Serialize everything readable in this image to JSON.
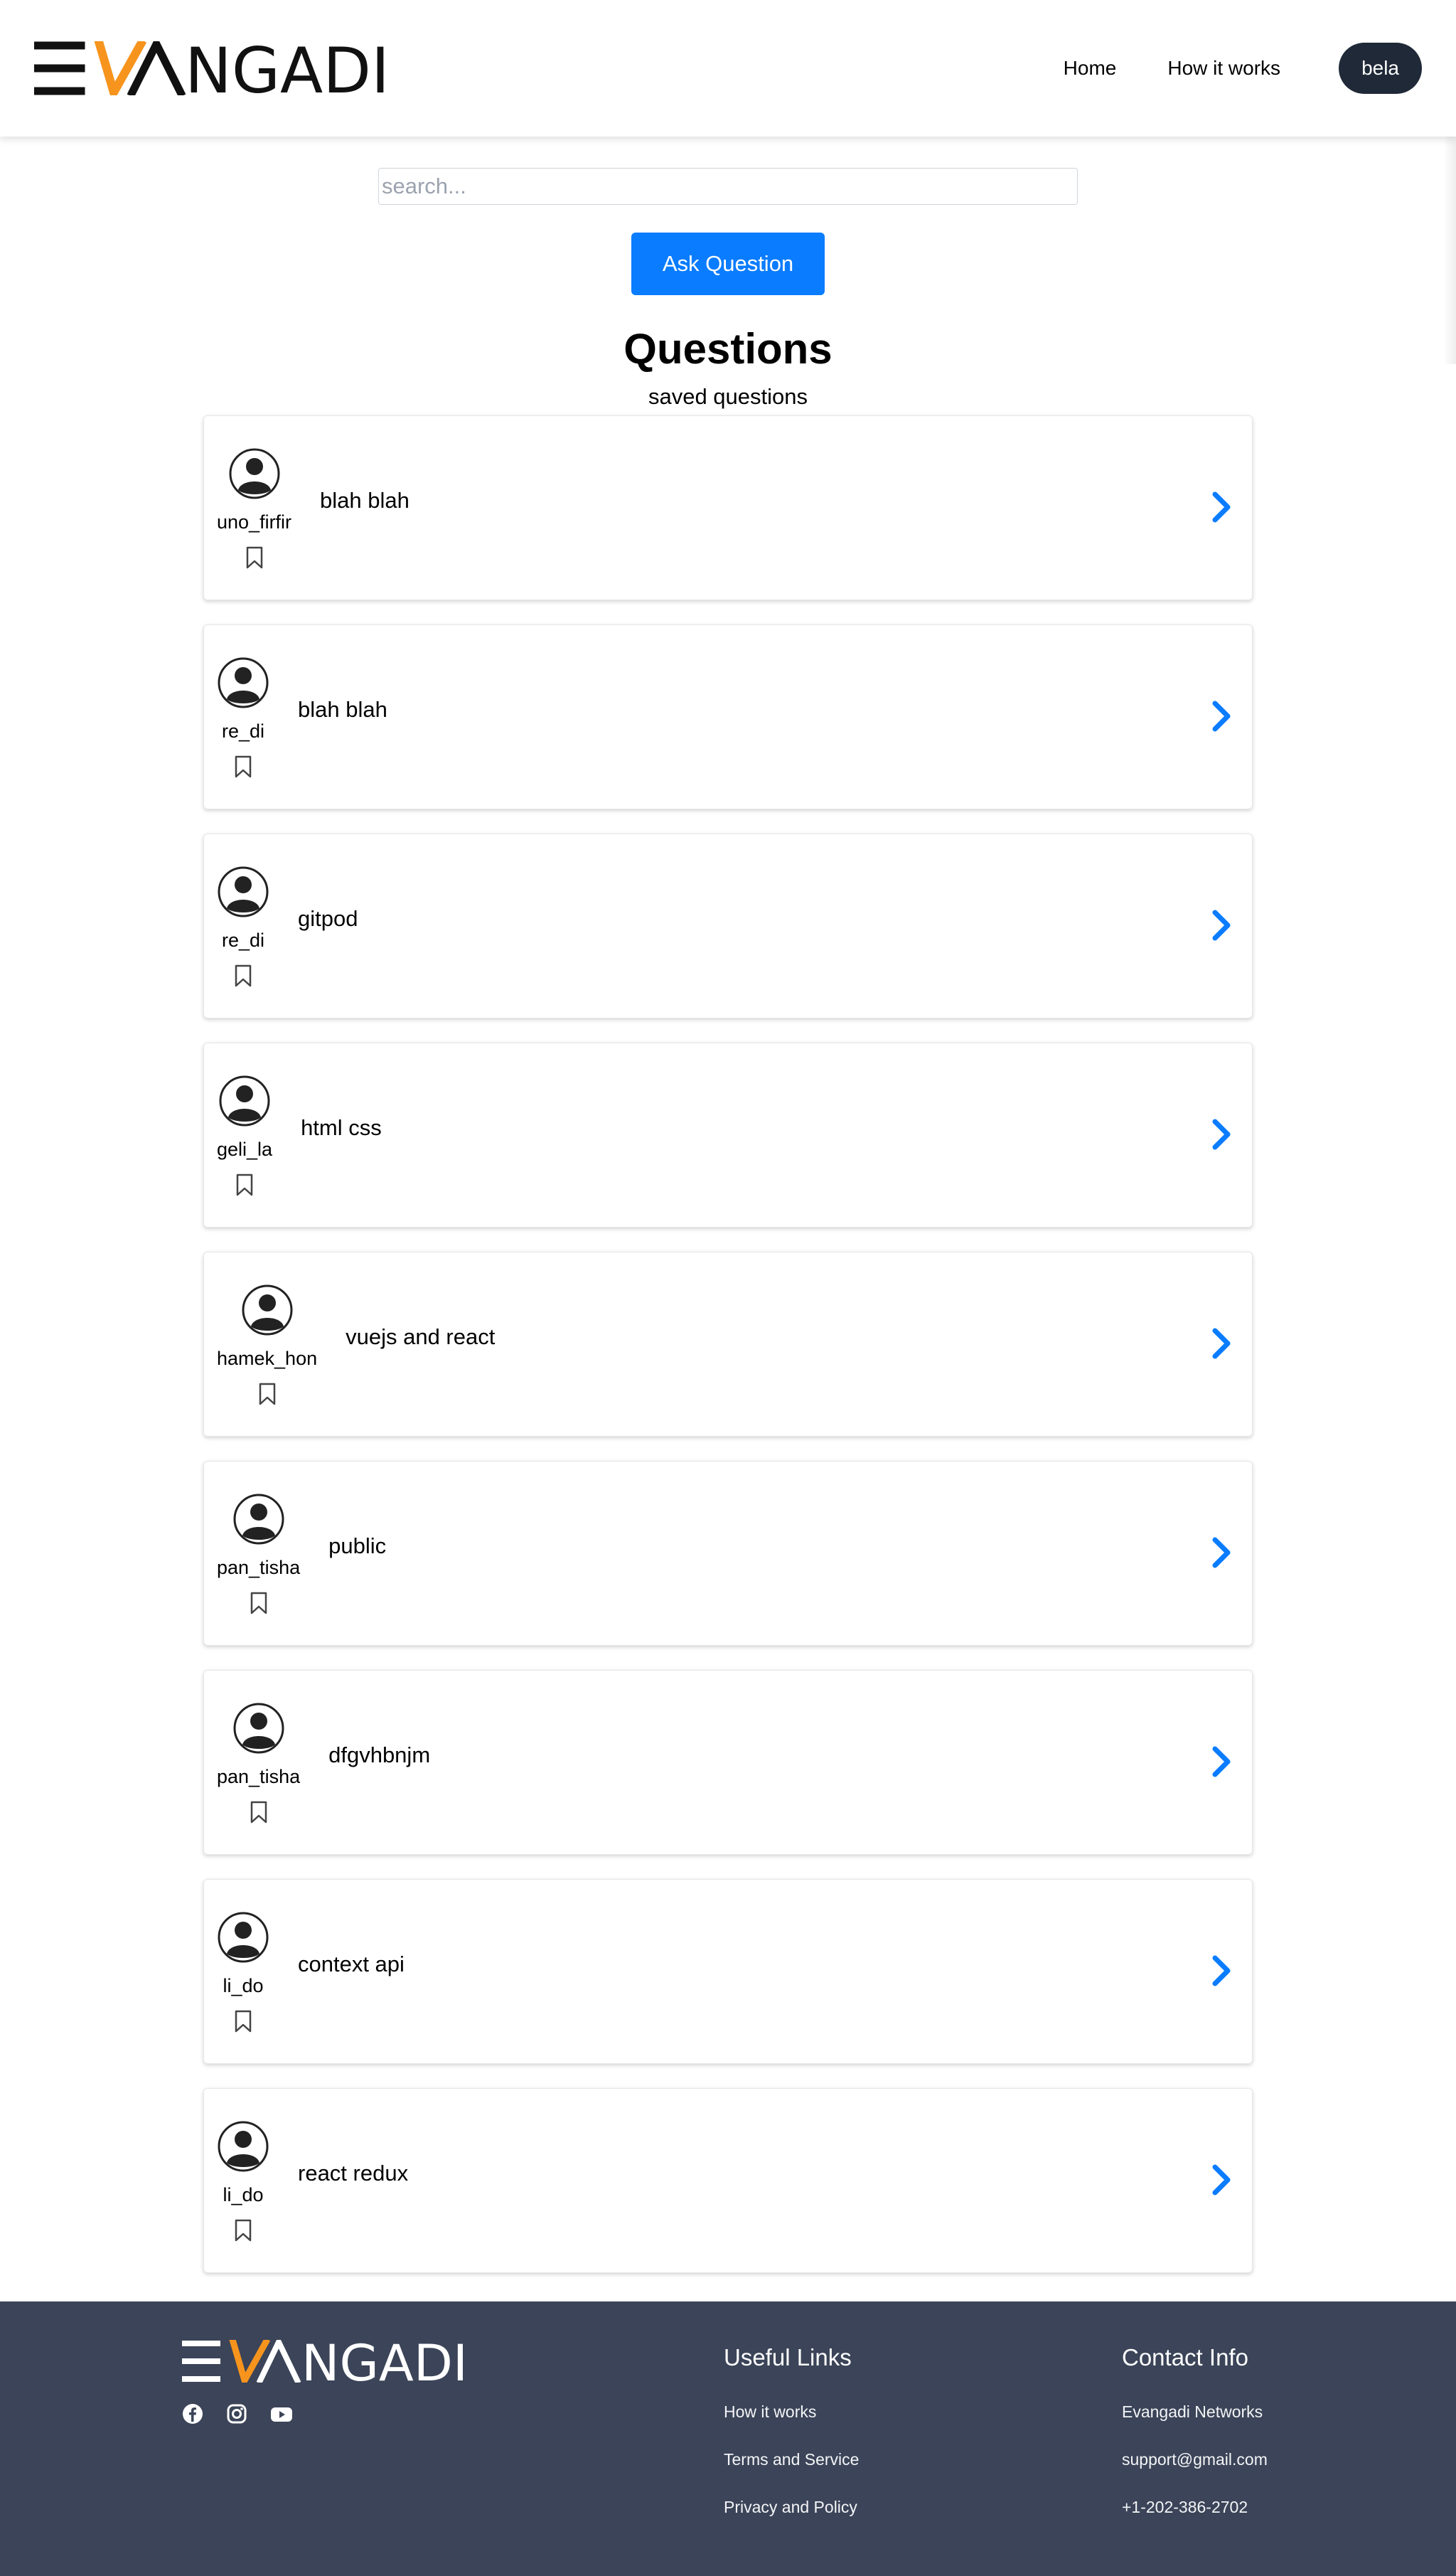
{
  "header": {
    "logo_text": "EVANGADI",
    "nav": [
      {
        "label": "Home"
      },
      {
        "label": "How it works"
      }
    ],
    "user_label": "bela"
  },
  "search": {
    "placeholder": "search...",
    "value": ""
  },
  "ask_button_label": "Ask Question",
  "page_title": "Questions",
  "page_subtitle": "saved questions",
  "questions": [
    {
      "username": "uno_firfir",
      "title": "blah blah"
    },
    {
      "username": "re_di",
      "title": "blah blah"
    },
    {
      "username": "re_di",
      "title": "gitpod"
    },
    {
      "username": "geli_la",
      "title": "html css"
    },
    {
      "username": "hamek_hon",
      "title": "vuejs and react"
    },
    {
      "username": "pan_tisha",
      "title": "public"
    },
    {
      "username": "pan_tisha",
      "title": "dfgvhbnjm"
    },
    {
      "username": "li_do",
      "title": "context api"
    },
    {
      "username": "li_do",
      "title": "react redux"
    }
  ],
  "footer": {
    "logo_text": "EVANGADI",
    "social_icons": [
      "facebook-icon",
      "instagram-icon",
      "youtube-icon"
    ],
    "useful_links": {
      "heading": "Useful Links",
      "items": [
        "How it works",
        "Terms and Service",
        "Privacy and Policy"
      ]
    },
    "contact": {
      "heading": "Contact Info",
      "items": [
        "Evangadi Networks",
        "support@gmail.com",
        "+1-202-386-2702"
      ]
    }
  },
  "colors": {
    "accent_blue": "#0a7cff",
    "logo_orange": "#f7941d",
    "user_button": "#1f2937",
    "footer_bg": "#3b4458"
  }
}
